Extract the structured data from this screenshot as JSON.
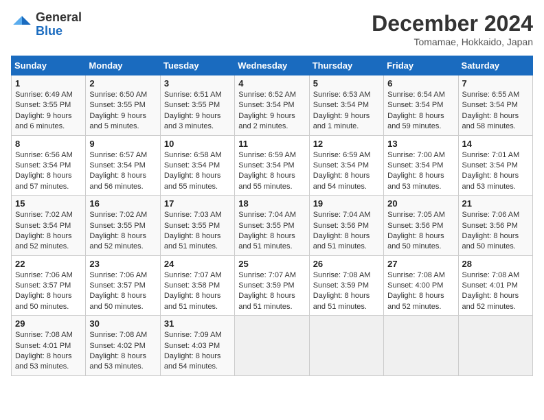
{
  "header": {
    "logo_line1": "General",
    "logo_line2": "Blue",
    "title": "December 2024",
    "subtitle": "Tomamae, Hokkaido, Japan"
  },
  "calendar": {
    "weekdays": [
      "Sunday",
      "Monday",
      "Tuesday",
      "Wednesday",
      "Thursday",
      "Friday",
      "Saturday"
    ],
    "weeks": [
      [
        {
          "day": 1,
          "sunrise": "6:49 AM",
          "sunset": "3:55 PM",
          "daylight": "9 hours and 6 minutes."
        },
        {
          "day": 2,
          "sunrise": "6:50 AM",
          "sunset": "3:55 PM",
          "daylight": "9 hours and 5 minutes."
        },
        {
          "day": 3,
          "sunrise": "6:51 AM",
          "sunset": "3:55 PM",
          "daylight": "9 hours and 3 minutes."
        },
        {
          "day": 4,
          "sunrise": "6:52 AM",
          "sunset": "3:54 PM",
          "daylight": "9 hours and 2 minutes."
        },
        {
          "day": 5,
          "sunrise": "6:53 AM",
          "sunset": "3:54 PM",
          "daylight": "9 hours and 1 minute."
        },
        {
          "day": 6,
          "sunrise": "6:54 AM",
          "sunset": "3:54 PM",
          "daylight": "8 hours and 59 minutes."
        },
        {
          "day": 7,
          "sunrise": "6:55 AM",
          "sunset": "3:54 PM",
          "daylight": "8 hours and 58 minutes."
        }
      ],
      [
        {
          "day": 8,
          "sunrise": "6:56 AM",
          "sunset": "3:54 PM",
          "daylight": "8 hours and 57 minutes."
        },
        {
          "day": 9,
          "sunrise": "6:57 AM",
          "sunset": "3:54 PM",
          "daylight": "8 hours and 56 minutes."
        },
        {
          "day": 10,
          "sunrise": "6:58 AM",
          "sunset": "3:54 PM",
          "daylight": "8 hours and 55 minutes."
        },
        {
          "day": 11,
          "sunrise": "6:59 AM",
          "sunset": "3:54 PM",
          "daylight": "8 hours and 55 minutes."
        },
        {
          "day": 12,
          "sunrise": "6:59 AM",
          "sunset": "3:54 PM",
          "daylight": "8 hours and 54 minutes."
        },
        {
          "day": 13,
          "sunrise": "7:00 AM",
          "sunset": "3:54 PM",
          "daylight": "8 hours and 53 minutes."
        },
        {
          "day": 14,
          "sunrise": "7:01 AM",
          "sunset": "3:54 PM",
          "daylight": "8 hours and 53 minutes."
        }
      ],
      [
        {
          "day": 15,
          "sunrise": "7:02 AM",
          "sunset": "3:54 PM",
          "daylight": "8 hours and 52 minutes."
        },
        {
          "day": 16,
          "sunrise": "7:02 AM",
          "sunset": "3:55 PM",
          "daylight": "8 hours and 52 minutes."
        },
        {
          "day": 17,
          "sunrise": "7:03 AM",
          "sunset": "3:55 PM",
          "daylight": "8 hours and 51 minutes."
        },
        {
          "day": 18,
          "sunrise": "7:04 AM",
          "sunset": "3:55 PM",
          "daylight": "8 hours and 51 minutes."
        },
        {
          "day": 19,
          "sunrise": "7:04 AM",
          "sunset": "3:56 PM",
          "daylight": "8 hours and 51 minutes."
        },
        {
          "day": 20,
          "sunrise": "7:05 AM",
          "sunset": "3:56 PM",
          "daylight": "8 hours and 50 minutes."
        },
        {
          "day": 21,
          "sunrise": "7:06 AM",
          "sunset": "3:56 PM",
          "daylight": "8 hours and 50 minutes."
        }
      ],
      [
        {
          "day": 22,
          "sunrise": "7:06 AM",
          "sunset": "3:57 PM",
          "daylight": "8 hours and 50 minutes."
        },
        {
          "day": 23,
          "sunrise": "7:06 AM",
          "sunset": "3:57 PM",
          "daylight": "8 hours and 50 minutes."
        },
        {
          "day": 24,
          "sunrise": "7:07 AM",
          "sunset": "3:58 PM",
          "daylight": "8 hours and 51 minutes."
        },
        {
          "day": 25,
          "sunrise": "7:07 AM",
          "sunset": "3:59 PM",
          "daylight": "8 hours and 51 minutes."
        },
        {
          "day": 26,
          "sunrise": "7:08 AM",
          "sunset": "3:59 PM",
          "daylight": "8 hours and 51 minutes."
        },
        {
          "day": 27,
          "sunrise": "7:08 AM",
          "sunset": "4:00 PM",
          "daylight": "8 hours and 52 minutes."
        },
        {
          "day": 28,
          "sunrise": "7:08 AM",
          "sunset": "4:01 PM",
          "daylight": "8 hours and 52 minutes."
        }
      ],
      [
        {
          "day": 29,
          "sunrise": "7:08 AM",
          "sunset": "4:01 PM",
          "daylight": "8 hours and 53 minutes."
        },
        {
          "day": 30,
          "sunrise": "7:08 AM",
          "sunset": "4:02 PM",
          "daylight": "8 hours and 53 minutes."
        },
        {
          "day": 31,
          "sunrise": "7:09 AM",
          "sunset": "4:03 PM",
          "daylight": "8 hours and 54 minutes."
        },
        null,
        null,
        null,
        null
      ]
    ]
  }
}
